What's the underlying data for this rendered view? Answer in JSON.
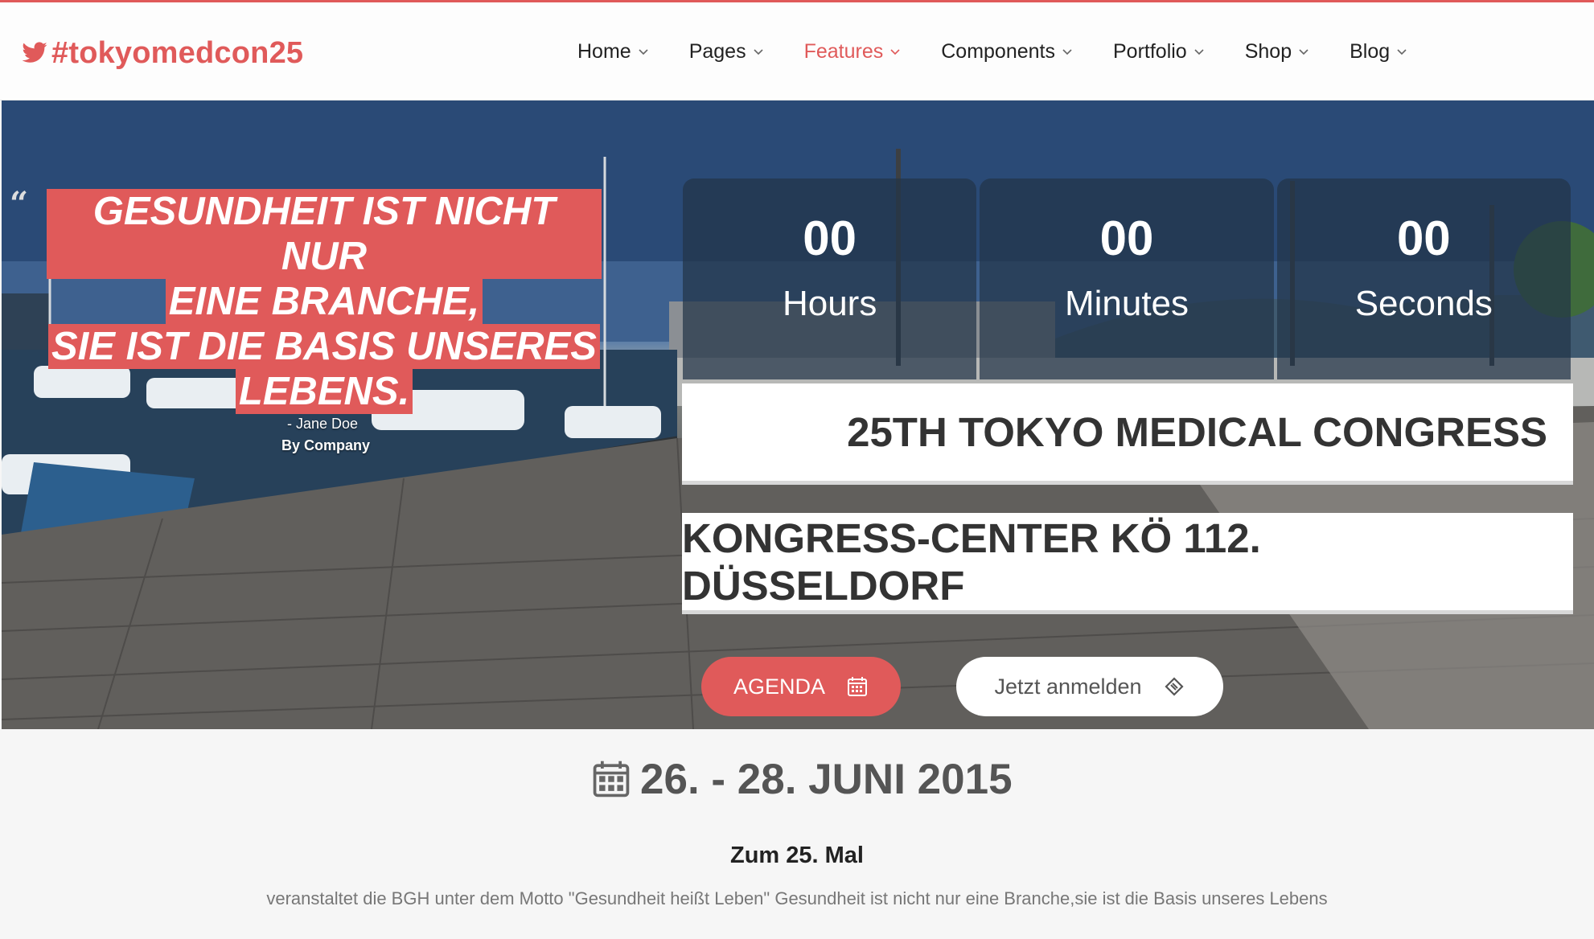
{
  "brand": {
    "text": "#tokyomedcon25",
    "icon": "twitter-bird-icon",
    "color": "#e05a5a"
  },
  "nav": {
    "items": [
      {
        "label": "Home",
        "active": false
      },
      {
        "label": "Pages",
        "active": false
      },
      {
        "label": "Features",
        "active": true
      },
      {
        "label": "Components",
        "active": false
      },
      {
        "label": "Portfolio",
        "active": false
      },
      {
        "label": "Shop",
        "active": false
      },
      {
        "label": "Blog",
        "active": false
      }
    ],
    "dropdown_icon": "chevron-down-icon"
  },
  "hero": {
    "quote_mark": "“",
    "quote_lines": [
      "Gesundheit ist nicht nur",
      "eine Branche,",
      "sie ist die Basis unseres",
      "Lebens."
    ],
    "quote_author": "- Jane Doe",
    "quote_company": "By Company",
    "countdown": [
      {
        "value": "00",
        "label": "Hours"
      },
      {
        "value": "00",
        "label": "Minutes"
      },
      {
        "value": "00",
        "label": "Seconds"
      }
    ],
    "title": "25TH TOKYO MEDICAL CONGRESS",
    "venue": "KONGRESS-CENTER KÖ 112. DÜSSELDORF",
    "buttons": {
      "agenda": {
        "label": "AGENDA",
        "icon": "calendar-icon"
      },
      "register": {
        "label": "Jetzt anmelden",
        "icon": "ticket-icon"
      }
    }
  },
  "event": {
    "date": "26. - 28. JUNI 2015",
    "date_icon": "calendar-icon",
    "subhead": "Zum 25. Mal",
    "description": "veranstaltet die BGH unter dem Motto \"Gesundheit heißt Leben\" Gesundheit ist nicht nur eine Branche,sie ist die Basis unseres Lebens"
  },
  "colors": {
    "accent": "#e05a5a",
    "text": "#333333",
    "muted": "#777777"
  }
}
